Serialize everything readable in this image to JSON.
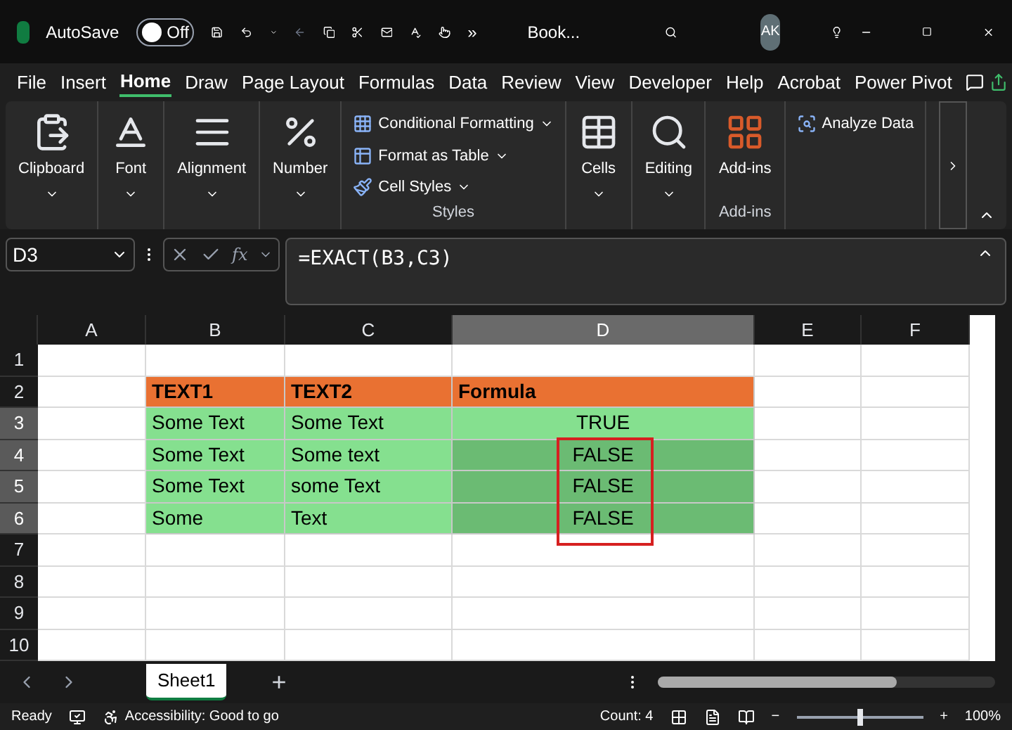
{
  "title_bar": {
    "autosave_label": "AutoSave",
    "autosave": {
      "label": "Off",
      "on": false
    },
    "more": "»",
    "file_name": "Book...",
    "avatar": "AK"
  },
  "menu_tabs": [
    {
      "label": "File",
      "selected": false
    },
    {
      "label": "Insert",
      "selected": false
    },
    {
      "label": "Home",
      "selected": true
    },
    {
      "label": "Draw",
      "selected": false
    },
    {
      "label": "Page Layout",
      "selected": false
    },
    {
      "label": "Formulas",
      "selected": false
    },
    {
      "label": "Data",
      "selected": false
    },
    {
      "label": "Review",
      "selected": false
    },
    {
      "label": "View",
      "selected": false
    },
    {
      "label": "Developer",
      "selected": false
    },
    {
      "label": "Help",
      "selected": false
    },
    {
      "label": "Acrobat",
      "selected": false
    },
    {
      "label": "Power Pivot",
      "selected": false
    }
  ],
  "ribbon": [
    {
      "kind": "big",
      "label": "Clipboard",
      "dropdown": true
    },
    {
      "kind": "big",
      "label": "Font",
      "dropdown": true
    },
    {
      "kind": "big",
      "label": "Alignment",
      "dropdown": true
    },
    {
      "kind": "big",
      "label": "Number",
      "dropdown": true
    },
    {
      "kind": "list",
      "items": [
        {
          "label": "Conditional Formatting",
          "dropdown": true
        },
        {
          "label": "Format as Table",
          "dropdown": true
        },
        {
          "label": "Cell Styles",
          "dropdown": true
        }
      ],
      "group_label": "Styles"
    },
    {
      "kind": "big",
      "label": "Cells",
      "dropdown": true
    },
    {
      "kind": "big",
      "label": "Editing",
      "dropdown": true
    },
    {
      "kind": "big",
      "label": "Add-ins",
      "dropdown": false,
      "group_label": "Add-ins"
    },
    {
      "kind": "list",
      "items": [
        {
          "label": "Analyze Data",
          "dropdown": false
        }
      ]
    }
  ],
  "formula_bar": {
    "name_box": "D3",
    "function_label": "fx",
    "formula": "=EXACT(B3,C3)"
  },
  "columns": [
    {
      "label": "A",
      "selected": false
    },
    {
      "label": "B",
      "selected": false
    },
    {
      "label": "C",
      "selected": false
    },
    {
      "label": "D",
      "selected": true
    },
    {
      "label": "E",
      "selected": false
    },
    {
      "label": "F",
      "selected": false
    }
  ],
  "rows": [
    {
      "label": "1",
      "selected": false,
      "cells": [
        null,
        null,
        null,
        null,
        null,
        null
      ]
    },
    {
      "label": "2",
      "selected": false,
      "cells": [
        null,
        {
          "text": "TEXT1",
          "kind": "header"
        },
        {
          "text": "TEXT2",
          "kind": "header"
        },
        {
          "text": "Formula",
          "kind": "header"
        },
        null,
        null
      ]
    },
    {
      "label": "3",
      "selected": true,
      "cells": [
        null,
        {
          "text": "Some Text",
          "kind": "data",
          "selected": false
        },
        {
          "text": "Some Text",
          "kind": "data",
          "selected": false
        },
        {
          "text": "TRUE",
          "kind": "result",
          "selected": false
        },
        null,
        null
      ]
    },
    {
      "label": "4",
      "selected": true,
      "cells": [
        null,
        {
          "text": "Some Text",
          "kind": "data",
          "selected": false
        },
        {
          "text": "Some text",
          "kind": "data",
          "selected": false
        },
        {
          "text": "FALSE",
          "kind": "result",
          "selected": true
        },
        null,
        null
      ]
    },
    {
      "label": "5",
      "selected": true,
      "cells": [
        null,
        {
          "text": "Some Text",
          "kind": "data",
          "selected": false
        },
        {
          "text": "some Text",
          "kind": "data",
          "selected": false
        },
        {
          "text": "FALSE",
          "kind": "result",
          "selected": true
        },
        null,
        null
      ]
    },
    {
      "label": "6",
      "selected": true,
      "cells": [
        null,
        {
          "text": "Some",
          "kind": "data",
          "selected": false
        },
        {
          "text": "Text",
          "kind": "data",
          "selected": false
        },
        {
          "text": "FALSE",
          "kind": "result",
          "selected": true
        },
        null,
        null
      ]
    },
    {
      "label": "7",
      "selected": false,
      "cells": [
        null,
        null,
        null,
        null,
        null,
        null
      ]
    },
    {
      "label": "8",
      "selected": false,
      "cells": [
        null,
        null,
        null,
        null,
        null,
        null
      ]
    },
    {
      "label": "9",
      "selected": false,
      "cells": [
        null,
        null,
        null,
        null,
        null,
        null
      ]
    },
    {
      "label": "10",
      "selected": false,
      "cells": [
        null,
        null,
        null,
        null,
        null,
        null
      ]
    }
  ],
  "sheet_tabs": [
    {
      "label": "Sheet1",
      "selected": true
    }
  ],
  "add_sheet": "+",
  "status_bar": {
    "ready": "Ready",
    "accessibility": "Accessibility: Good to go",
    "count": "Count: 4",
    "zoom": {
      "level": 0.5,
      "reading": "100%"
    },
    "zoom_minus": "−",
    "zoom_plus": "+"
  }
}
